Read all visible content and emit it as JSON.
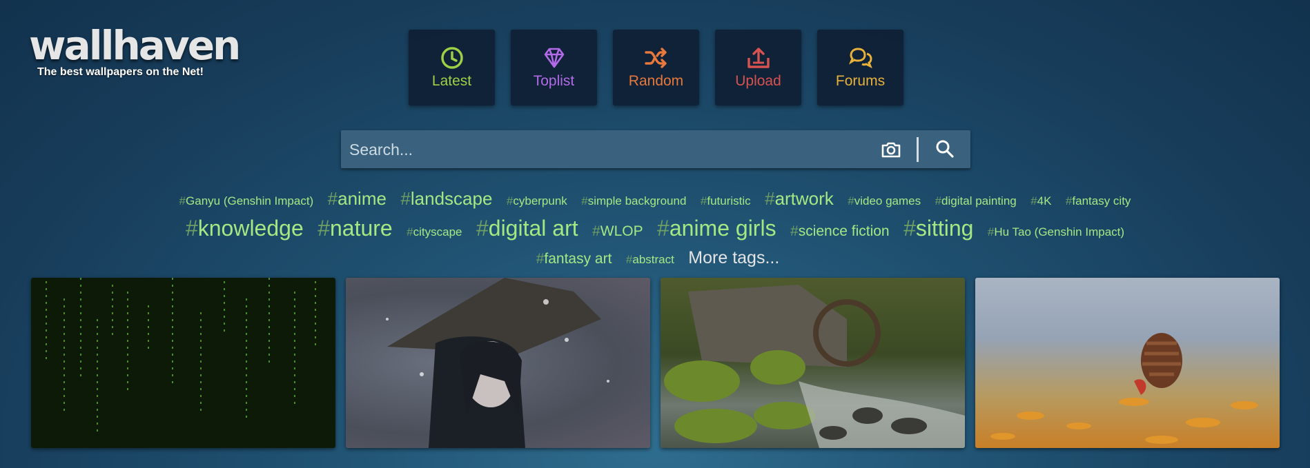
{
  "logo": {
    "name": "wallhaven",
    "tagline": "The best wallpapers on the Net!"
  },
  "nav": [
    {
      "label": "Latest",
      "icon": "clock-icon",
      "color": "#9ed046"
    },
    {
      "label": "Toplist",
      "icon": "diamond-icon",
      "color": "#b36ae8"
    },
    {
      "label": "Random",
      "icon": "shuffle-icon",
      "color": "#e6793b"
    },
    {
      "label": "Upload",
      "icon": "upload-icon",
      "color": "#d8524f"
    },
    {
      "label": "Forums",
      "icon": "chat-icon",
      "color": "#e8b13a"
    }
  ],
  "search": {
    "placeholder": "Search..."
  },
  "tags": {
    "line1": [
      "Ganyu (Genshin Impact)",
      "anime",
      "landscape",
      "cyberpunk",
      "simple background",
      "futuristic",
      "artwork",
      "video games",
      "digital painting",
      "4K",
      "fantasy city"
    ],
    "line2": [
      "knowledge",
      "nature",
      "cityscape",
      "digital art",
      "WLOP",
      "anime girls",
      "science fiction",
      "sitting",
      "Hu Tao (Genshin Impact)"
    ],
    "line3": [
      "fantasy art",
      "abstract"
    ],
    "more": "More tags..."
  },
  "thumbnails": [
    {
      "alt": "green matrix rain"
    },
    {
      "alt": "anime girl with hat in snow"
    },
    {
      "alt": "mossy stream with water mill"
    },
    {
      "alt": "pine cone on autumn leaves"
    }
  ]
}
